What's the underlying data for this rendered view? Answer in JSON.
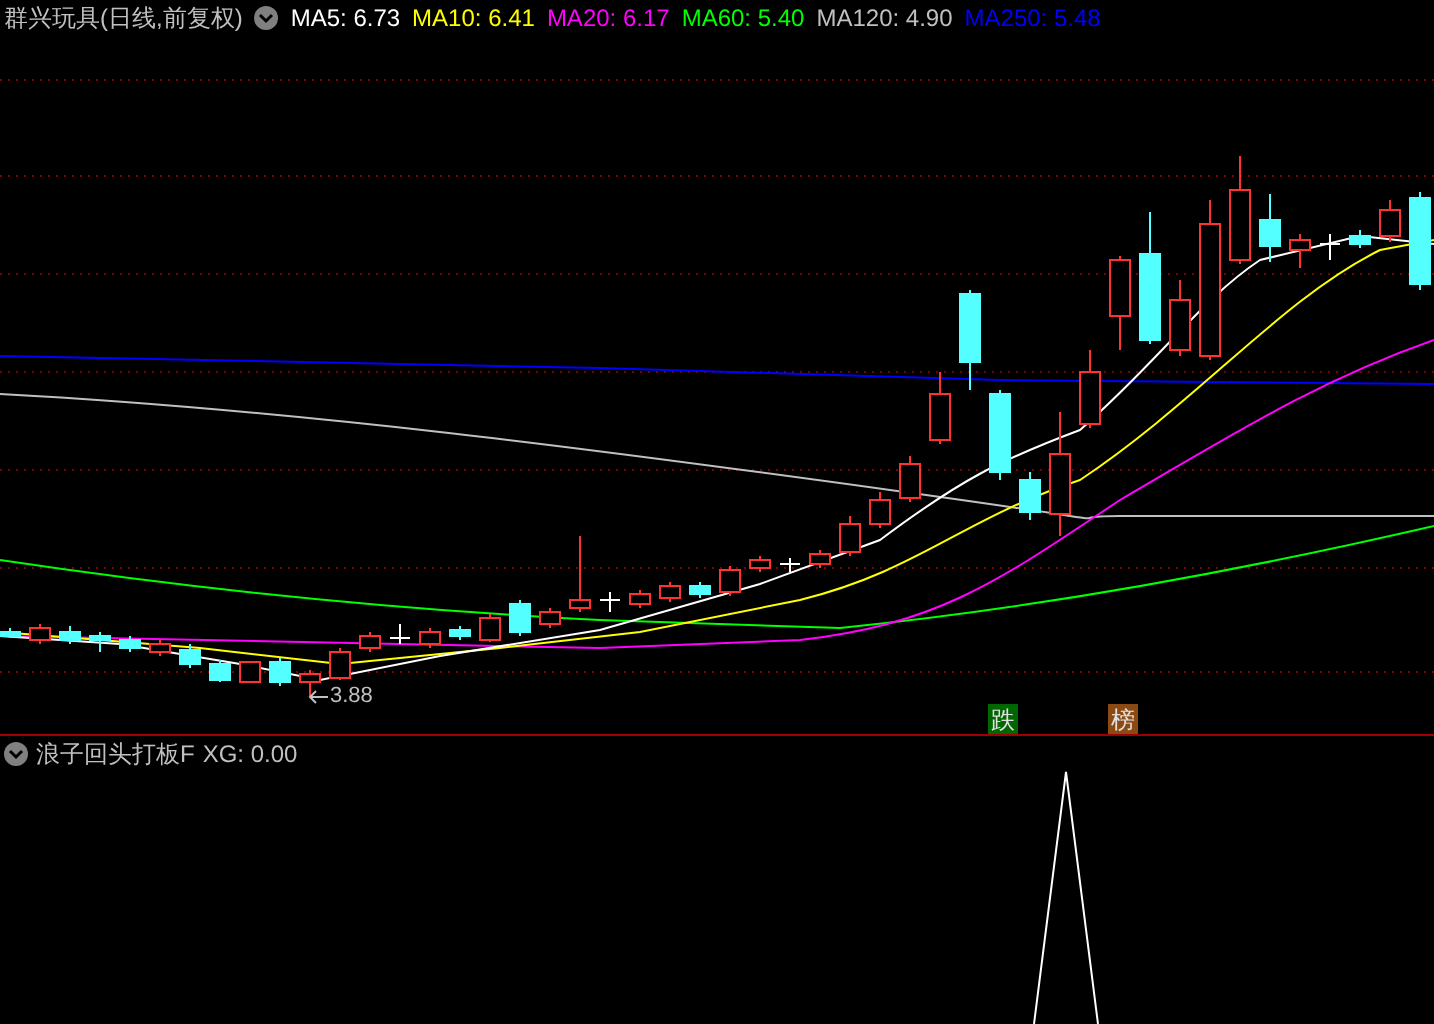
{
  "stock_header": {
    "title": "群兴玩具(日线,前复权)",
    "moving_averages": [
      {
        "label": "MA5:",
        "value": "6.73",
        "color": "#ffffff"
      },
      {
        "label": "MA10:",
        "value": "6.41",
        "color": "#ffff00"
      },
      {
        "label": "MA20:",
        "value": "6.17",
        "color": "#ff00ff"
      },
      {
        "label": "MA60:",
        "value": "5.40",
        "color": "#00ff00"
      },
      {
        "label": "MA120:",
        "value": "4.90",
        "color": "#c0c0c0"
      },
      {
        "label": "MA250:",
        "value": "5.48",
        "color": "#0000ff"
      }
    ]
  },
  "price_chart": {
    "low_marker": "3.88",
    "badges": [
      {
        "text": "跌",
        "color": "#006600"
      },
      {
        "text": "榜",
        "color": "#8b4a14"
      }
    ]
  },
  "indicator": {
    "title": "浪子回头打板F",
    "reading": "XG: 0.00"
  }
}
